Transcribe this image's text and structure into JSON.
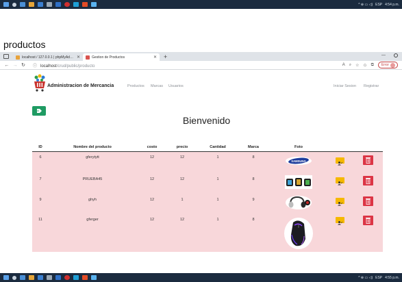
{
  "taskbar_top": {
    "tray": {
      "lang": "ESP",
      "time": "4:54 p.m."
    }
  },
  "taskbar_bottom": {
    "tray": {
      "lang": "ESP",
      "time": "4:55 p.m."
    }
  },
  "caption": "productos",
  "browser": {
    "tabs": [
      {
        "label": "localhost / 127.0.0.1 | phpMyAdmin",
        "close": "✕",
        "active": false
      },
      {
        "label": "Gestion de Productos",
        "close": "✕",
        "active": true
      }
    ],
    "new_tab": "+",
    "window_min": "—",
    "url_host": "localhost",
    "url_path": "/crud/public/producto",
    "error_badge": "Error"
  },
  "navbar": {
    "brand": "Administracion de Mercancia",
    "links": [
      "Productos",
      "Marcas",
      "Usuarios"
    ],
    "login": "Iniciar Sesion",
    "register": "Registrar"
  },
  "heading": "Bienvenido",
  "table": {
    "columns": [
      "ID",
      "Nombre del producto",
      "costo",
      "precio",
      "Cantidad",
      "Marca",
      "Foto"
    ],
    "rows": [
      {
        "id": "6",
        "nombre": "gferytytt",
        "costo": "12",
        "precio": "12",
        "cantidad": "1",
        "marca": "8",
        "foto": "samsung-logo",
        "foto_text": "SAMSUNG"
      },
      {
        "id": "7",
        "nombre": "PRUEBA45",
        "costo": "12",
        "precio": "12",
        "cantidad": "1",
        "marca": "8",
        "foto": "smartwatches"
      },
      {
        "id": "9",
        "nombre": "ghyh",
        "costo": "12",
        "precio": "1",
        "cantidad": "1",
        "marca": "9",
        "foto": "headphones"
      },
      {
        "id": "11",
        "nombre": "gferger",
        "costo": "12",
        "precio": "12",
        "cantidad": "1",
        "marca": "8",
        "foto": "gaming-mouse"
      }
    ]
  },
  "colors": {
    "taskbar": "#1b2b3f",
    "table_body": "#f8d7da",
    "tag_button": "#1f9b63",
    "edit_button": "#f5b800",
    "delete_button": "#dc3545"
  },
  "icons": [
    "windows-icon",
    "search-icon",
    "tag-icon",
    "user-edit-icon",
    "trash-icon",
    "cart-logo-icon"
  ]
}
